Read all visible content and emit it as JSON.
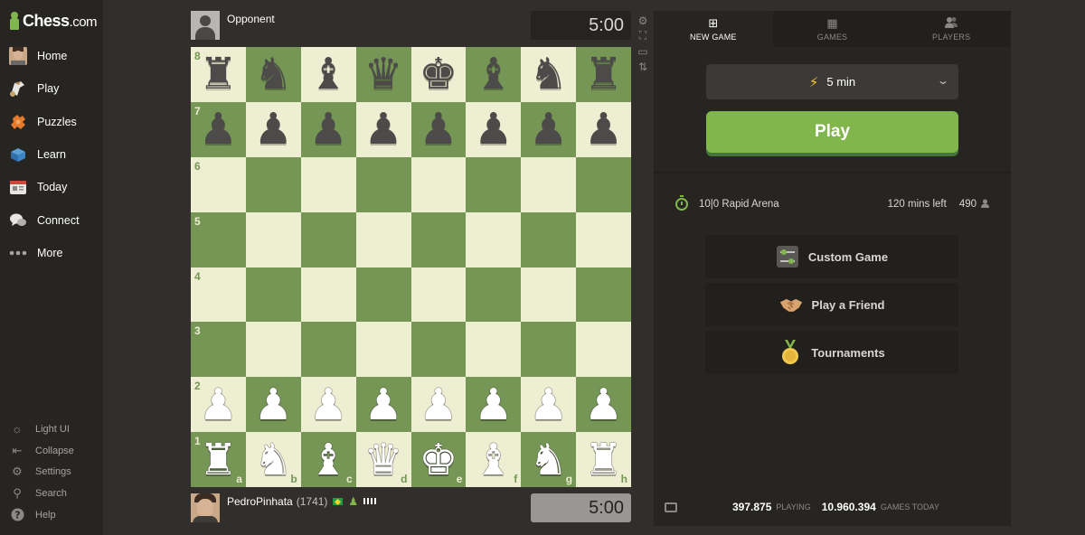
{
  "brand": {
    "name": "Chess",
    "suffix": ".com"
  },
  "sidebar": {
    "items": [
      {
        "label": "Home",
        "icon": "home-avatar-icon"
      },
      {
        "label": "Play",
        "icon": "play-icon"
      },
      {
        "label": "Puzzles",
        "icon": "puzzles-icon"
      },
      {
        "label": "Learn",
        "icon": "learn-icon"
      },
      {
        "label": "Today",
        "icon": "today-icon"
      },
      {
        "label": "Connect",
        "icon": "connect-icon"
      },
      {
        "label": "More",
        "icon": "more-icon"
      }
    ],
    "bottom": [
      {
        "label": "Light UI",
        "icon": "sun-icon",
        "glyph": "☼"
      },
      {
        "label": "Collapse",
        "icon": "collapse-icon",
        "glyph": "⇤"
      },
      {
        "label": "Settings",
        "icon": "gear-icon",
        "glyph": "⚙"
      },
      {
        "label": "Search",
        "icon": "search-icon",
        "glyph": "⚲"
      },
      {
        "label": "Help",
        "icon": "help-icon",
        "glyph": "?"
      }
    ]
  },
  "opponent": {
    "name": "Opponent",
    "clock": "5:00"
  },
  "player": {
    "name": "PedroPinhata",
    "rating": "(1741)",
    "clock": "5:00"
  },
  "board": {
    "ranks": [
      "8",
      "7",
      "6",
      "5",
      "4",
      "3",
      "2",
      "1"
    ],
    "files": [
      "a",
      "b",
      "c",
      "d",
      "e",
      "f",
      "g",
      "h"
    ],
    "light_color": "#eeeed2",
    "dark_color": "#769656",
    "position": [
      [
        "br",
        "bn",
        "bb",
        "bq",
        "bk",
        "bb",
        "bn",
        "br"
      ],
      [
        "bp",
        "bp",
        "bp",
        "bp",
        "bp",
        "bp",
        "bp",
        "bp"
      ],
      [
        "",
        "",
        "",
        "",
        "",
        "",
        "",
        ""
      ],
      [
        "",
        "",
        "",
        "",
        "",
        "",
        "",
        ""
      ],
      [
        "",
        "",
        "",
        "",
        "",
        "",
        "",
        ""
      ],
      [
        "",
        "",
        "",
        "",
        "",
        "",
        "",
        ""
      ],
      [
        "wp",
        "wp",
        "wp",
        "wp",
        "wp",
        "wp",
        "wp",
        "wp"
      ],
      [
        "wr",
        "wn",
        "wb",
        "wq",
        "wk",
        "wb",
        "wn",
        "wr"
      ]
    ]
  },
  "tabs": [
    {
      "label": "NEW GAME",
      "icon": "plus-square-icon",
      "glyph": "⊞",
      "active": true
    },
    {
      "label": "GAMES",
      "icon": "checkerboard-icon",
      "glyph": "▦",
      "active": false
    },
    {
      "label": "PLAYERS",
      "icon": "players-icon",
      "glyph": "👥",
      "active": false
    }
  ],
  "new_game": {
    "time_control": "5 min",
    "play_label": "Play",
    "arena": {
      "name": "10|0 Rapid Arena",
      "time_left": "120 mins left",
      "players": "490"
    },
    "options": [
      {
        "label": "Custom Game",
        "icon": "custom-game-icon"
      },
      {
        "label": "Play a Friend",
        "icon": "handshake-icon"
      },
      {
        "label": "Tournaments",
        "icon": "trophy-medal-icon"
      }
    ]
  },
  "footer": {
    "playing_count": "397.875",
    "playing_label": "PLAYING",
    "games_count": "10.960.394",
    "games_label": "GAMES TODAY"
  },
  "colors": {
    "accent": "#81b64c",
    "background": "#312e2b",
    "panel": "#272522"
  }
}
